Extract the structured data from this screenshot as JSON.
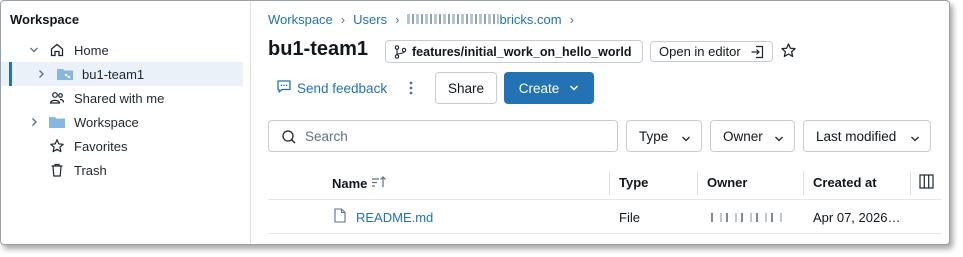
{
  "sidebar": {
    "title": "Workspace",
    "items": [
      {
        "label": "Home",
        "icon": "home-icon",
        "expanded": true
      },
      {
        "label": "bu1-team1",
        "icon": "repo-folder-icon",
        "selected": true
      },
      {
        "label": "Shared with me",
        "icon": "users-icon"
      },
      {
        "label": "Workspace",
        "icon": "folder-icon"
      },
      {
        "label": "Favorites",
        "icon": "star-icon"
      },
      {
        "label": "Trash",
        "icon": "trash-icon"
      }
    ]
  },
  "breadcrumb": {
    "items": [
      "Workspace",
      "Users"
    ],
    "user_suffix": "bricks.com",
    "separator": "›"
  },
  "header": {
    "title": "bu1-team1",
    "branch": "features/initial_work_on_hello_world",
    "open_in_editor": "Open in editor"
  },
  "actions": {
    "feedback": "Send feedback",
    "share": "Share",
    "create": "Create"
  },
  "filters": {
    "search_placeholder": "Search",
    "type": "Type",
    "owner": "Owner",
    "last_modified": "Last modified"
  },
  "table": {
    "columns": [
      "Name",
      "Type",
      "Owner",
      "Created at"
    ],
    "rows": [
      {
        "name": "README.md",
        "type": "File",
        "owner": "",
        "created_at": "Apr 07, 2026…"
      }
    ]
  },
  "colors": {
    "accent": "#2272b4",
    "selected_bg": "#eaf1f8",
    "border": "#c5ccd3"
  }
}
